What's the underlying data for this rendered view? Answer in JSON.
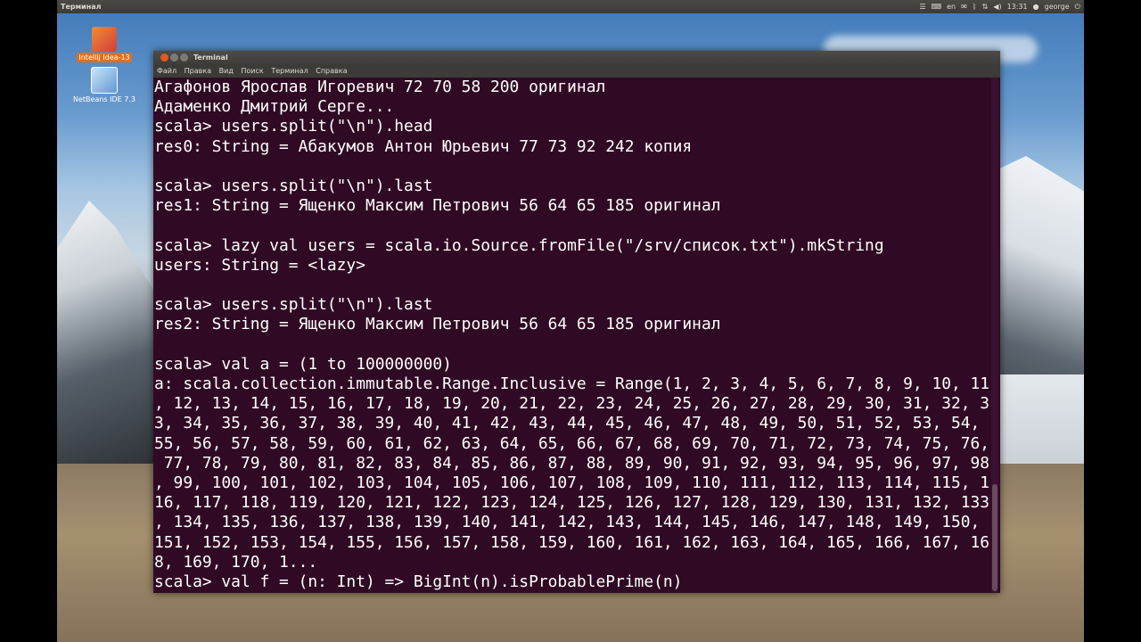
{
  "topbar": {
    "app_title": "Терминал",
    "keyboard": "en",
    "time": "13:31",
    "user": "george"
  },
  "desktop": {
    "icons": [
      {
        "label": "Intellij Idea-13"
      },
      {
        "label": "NetBeans IDE 7.3"
      }
    ]
  },
  "terminal": {
    "title": "Terminal",
    "menu": [
      "Файл",
      "Правка",
      "Вид",
      "Поиск",
      "Терминал",
      "Справка"
    ],
    "lines": [
      "Агафонов Ярослав Игоревич 72 70 58 200 оригинал",
      "Адаменко Дмитрий Серге...",
      "scala> users.split(\"\\n\").head",
      "res0: String = Абакумов Антон Юрьевич 77 73 92 242 копия",
      "",
      "scala> users.split(\"\\n\").last",
      "res1: String = Ященко Максим Петрович 56 64 65 185 оригинал",
      "",
      "scala> lazy val users = scala.io.Source.fromFile(\"/srv/список.txt\").mkString",
      "users: String = <lazy>",
      "",
      "scala> users.split(\"\\n\").last",
      "res2: String = Ященко Максим Петрович 56 64 65 185 оригинал",
      "",
      "scala> val a = (1 to 100000000)",
      "a: scala.collection.immutable.Range.Inclusive = Range(1, 2, 3, 4, 5, 6, 7, 8, 9, 10, 11",
      ", 12, 13, 14, 15, 16, 17, 18, 19, 20, 21, 22, 23, 24, 25, 26, 27, 28, 29, 30, 31, 32, 3",
      "3, 34, 35, 36, 37, 38, 39, 40, 41, 42, 43, 44, 45, 46, 47, 48, 49, 50, 51, 52, 53, 54,",
      "55, 56, 57, 58, 59, 60, 61, 62, 63, 64, 65, 66, 67, 68, 69, 70, 71, 72, 73, 74, 75, 76,",
      " 77, 78, 79, 80, 81, 82, 83, 84, 85, 86, 87, 88, 89, 90, 91, 92, 93, 94, 95, 96, 97, 98",
      ", 99, 100, 101, 102, 103, 104, 105, 106, 107, 108, 109, 110, 111, 112, 113, 114, 115, 1",
      "16, 117, 118, 119, 120, 121, 122, 123, 124, 125, 126, 127, 128, 129, 130, 131, 132, 133",
      ", 134, 135, 136, 137, 138, 139, 140, 141, 142, 143, 144, 145, 146, 147, 148, 149, 150,",
      "151, 152, 153, 154, 155, 156, 157, 158, 159, 160, 161, 162, 163, 164, 165, 166, 167, 16",
      "8, 169, 170, 1...",
      "scala> val f = (n: Int) => BigInt(n).isProbablePrime(n)"
    ]
  }
}
